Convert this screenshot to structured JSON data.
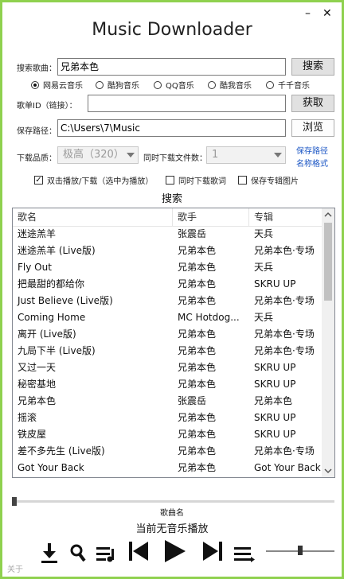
{
  "app": {
    "title": "Music Downloader",
    "minimize": "–",
    "close": "✕"
  },
  "search": {
    "label": "搜索歌曲：",
    "value": "兄弟本色",
    "button": "搜索"
  },
  "sources": [
    {
      "label": "网易云音乐",
      "selected": true
    },
    {
      "label": "酷狗音乐",
      "selected": false
    },
    {
      "label": "QQ音乐",
      "selected": false
    },
    {
      "label": "酷我音乐",
      "selected": false
    },
    {
      "label": "千千音乐",
      "selected": false
    }
  ],
  "playlist": {
    "label": "歌单ID（链接）：",
    "value": "",
    "button": "获取"
  },
  "save": {
    "label": "保存路径：",
    "value": "C:\\Users\\7\\Music",
    "button": "浏览"
  },
  "quality": {
    "label": "下载品质：",
    "value": "极高（320）"
  },
  "concurrent": {
    "label": "同时下载文件数：",
    "value": "1"
  },
  "links": {
    "save_path": "保存路径",
    "name_format": "名称格式"
  },
  "options": [
    {
      "label": "双击播放/下载（选中为播放）",
      "checked": true
    },
    {
      "label": "同时下载歌词",
      "checked": false
    },
    {
      "label": "保存专辑图片",
      "checked": false
    }
  ],
  "results_label": "搜索",
  "table": {
    "columns": [
      "歌名",
      "歌手",
      "专辑"
    ],
    "rows": [
      [
        "迷途羔羊",
        "张震岳",
        "天兵"
      ],
      [
        "迷途羔羊 (Live版)",
        "兄弟本色",
        "兄弟本色·专场"
      ],
      [
        "Fly Out",
        "兄弟本色",
        "天兵"
      ],
      [
        "把最甜的都给你",
        "兄弟本色",
        "SKRU UP"
      ],
      [
        "Just Believe (Live版)",
        "兄弟本色",
        "兄弟本色·专场"
      ],
      [
        "Coming Home",
        "MC Hotdog...",
        "天兵"
      ],
      [
        "离开 (Live版)",
        "兄弟本色",
        "兄弟本色·专场"
      ],
      [
        "九局下半 (Live版)",
        "兄弟本色",
        "兄弟本色·专场"
      ],
      [
        "又过一天",
        "兄弟本色",
        "SKRU UP"
      ],
      [
        "秘密基地",
        "兄弟本色",
        "SKRU UP"
      ],
      [
        "兄弟本色",
        "张震岳",
        "兄弟本色"
      ],
      [
        "摇滚",
        "兄弟本色",
        "SKRU UP"
      ],
      [
        "铁皮屋",
        "兄弟本色",
        "SKRU UP"
      ],
      [
        "差不多先生 (Live版)",
        "兄弟本色",
        "兄弟本色·专场"
      ],
      [
        "Got Your Back",
        "兄弟本色",
        "Got Your Back"
      ]
    ]
  },
  "player": {
    "song_name": "歌曲名",
    "status": "当前无音乐播放",
    "progress": 0,
    "volume": 0.5
  },
  "footer": {
    "about": "关于"
  },
  "icons": [
    "download-icon",
    "search-icon",
    "playlist-icon",
    "previous-icon",
    "play-icon",
    "next-icon",
    "menu-icon"
  ]
}
